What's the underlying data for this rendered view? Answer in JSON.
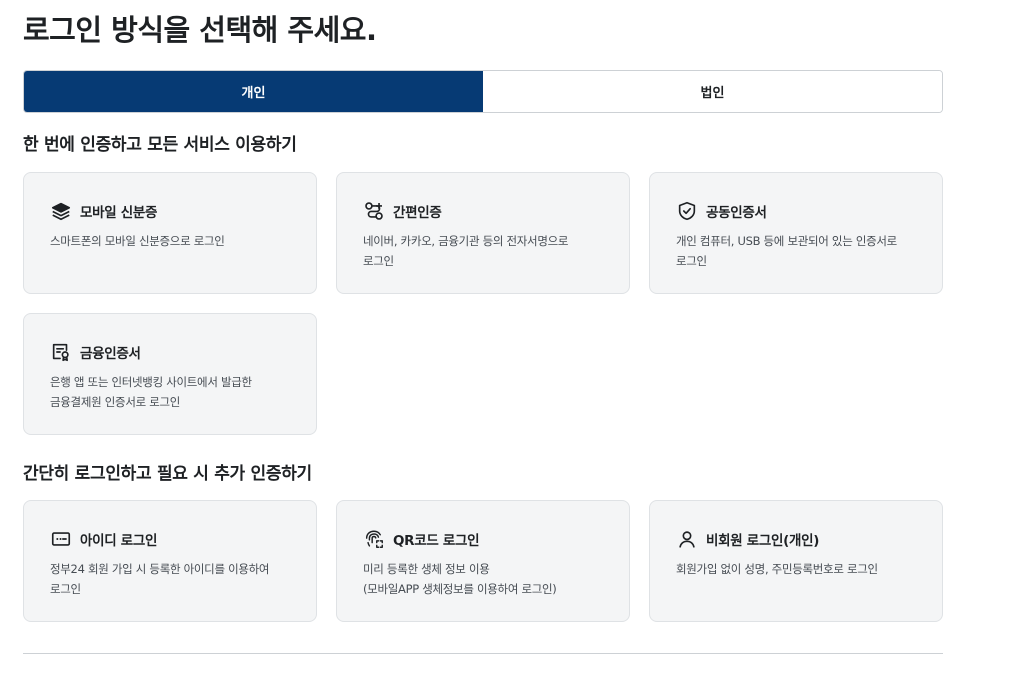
{
  "page": {
    "title": "로그인 방식을 선택해 주세요."
  },
  "tabs": [
    {
      "label": "개인",
      "active": true
    },
    {
      "label": "법인",
      "active": false
    }
  ],
  "sections": [
    {
      "heading": "한 번에 인증하고 모든 서비스 이용하기",
      "cards": [
        {
          "icon": "mobile-id-stack-icon",
          "title": "모바일 신분증",
          "desc": [
            "스마트폰의 모바일 신분증으로 로그인"
          ]
        },
        {
          "icon": "simple-auth-link-icon",
          "title": "간편인증",
          "desc": [
            "네이버, 카카오, 금융기관 등의 전자서명으로",
            "로그인"
          ]
        },
        {
          "icon": "shield-check-icon",
          "title": "공동인증서",
          "desc": [
            "개인 컴퓨터, USB 등에 보관되어 있는 인증서로",
            "로그인"
          ]
        },
        {
          "icon": "certificate-badge-icon",
          "title": "금융인증서",
          "desc": [
            "은행 앱 또는 인터넷뱅킹 사이트에서 발급한",
            "금융결제원 인증서로 로그인"
          ]
        }
      ]
    },
    {
      "heading": "간단히 로그인하고 필요 시 추가 인증하기",
      "cards": [
        {
          "icon": "id-password-icon",
          "title": "아이디 로그인",
          "desc": [
            "정부24 회원 가입 시 등록한 아이디를 이용하여",
            "로그인"
          ]
        },
        {
          "icon": "fingerprint-qr-icon",
          "title": "QR코드 로그인",
          "desc": [
            "미리 등록한 생체 정보 이용",
            "(모바일APP 생체정보를 이용하여 로그인)"
          ]
        },
        {
          "icon": "person-icon",
          "title": "비회원 로그인(개인)",
          "desc": [
            "회원가입 없이 성명, 주민등록번호로 로그인"
          ]
        }
      ]
    }
  ],
  "colors": {
    "primary": "#063a74",
    "card_bg": "#f4f5f6",
    "card_border": "#dfe2e5",
    "text": "#1e2124",
    "subtext": "#464c53"
  }
}
